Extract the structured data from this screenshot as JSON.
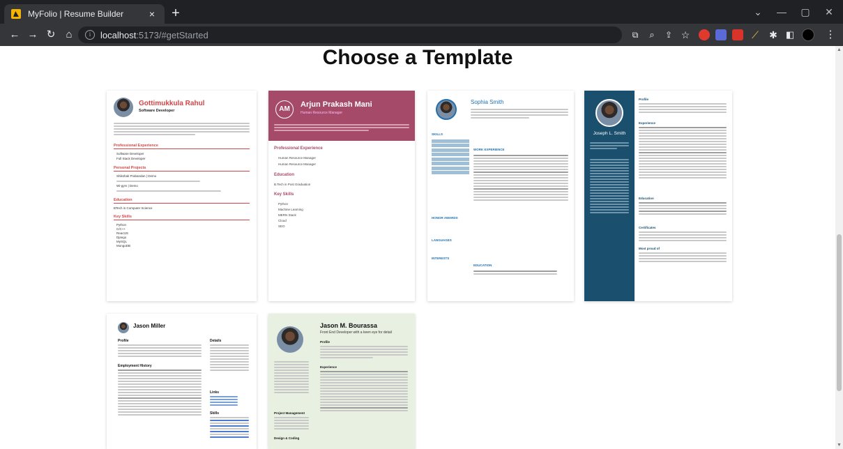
{
  "browser": {
    "tab_title": "MyFolio | Resume Builder",
    "tab_close": "×",
    "new_tab": "+",
    "url_host": "localhost",
    "url_path": ":5173/#getStarted",
    "window_controls": [
      "⌄",
      "—",
      "▢",
      "✕"
    ]
  },
  "page": {
    "title": "Choose a Template"
  },
  "templates": [
    {
      "name": "Gottimukkula Rahul",
      "role": "Software Developer",
      "sections": [
        "Professional Experience",
        "Personal Projects",
        "Education",
        "Key Skills"
      ],
      "items": [
        "Software Developer",
        "Full Stack Developer",
        "Shikshak Prabandan | Demo",
        "Wi-gym | Demo",
        "BTech in Computer Science"
      ],
      "skills": [
        "Python",
        "C/C++",
        "ReactJS",
        "Django",
        "MySQL",
        "MongoDB"
      ]
    },
    {
      "initials": "AM",
      "name": "Arjun Prakash Mani",
      "role": "Human Resource Manager",
      "sections": [
        "Professional Experience",
        "Education",
        "Key Skills"
      ],
      "items": [
        "Human Resource Manager",
        "Human Resource Manager",
        "B.Tech in Post Graduation"
      ],
      "skills": [
        "Python",
        "Machine Learning",
        "MERN Stack",
        "Cloud",
        "SEO"
      ]
    },
    {
      "name": "Sophia Smith",
      "sections": [
        "SKILLS",
        "WORK EXPERIENCE",
        "HONOR AWARDS",
        "LANGUAGES",
        "INTERESTS",
        "EDUCATION"
      ]
    },
    {
      "name": "Joseph L. Smith",
      "sections": [
        "Profile",
        "Experience",
        "Education",
        "Certificates",
        "Most proud of"
      ]
    },
    {
      "name": "Jason Miller",
      "sections": [
        "Profile",
        "Employment History",
        "Details",
        "Links",
        "Skills"
      ]
    },
    {
      "name": "Jason M. Bourassa",
      "role": "Front End Developer with a keen eye for detail",
      "sections": [
        "Profile",
        "Experience",
        "Project Management",
        "Design & Coding"
      ]
    }
  ]
}
